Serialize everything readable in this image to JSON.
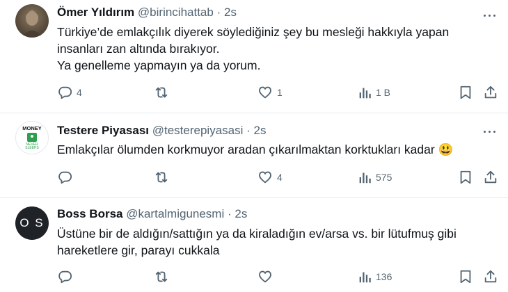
{
  "tweets": [
    {
      "name": "Ömer Yıldırım",
      "handle": "@birincihattab",
      "separator": "·",
      "time": "2s",
      "lines": [
        "Türkiye’de emlakçılık diyerek söylediğiniz şey bu mesleği hakkıyla yapan",
        "insanları zan altında bırakıyor.",
        "Ya genelleme yapmayın ya da yorum."
      ],
      "replies": "4",
      "retweets": "",
      "likes": "1",
      "views": "1 B",
      "avatar_icon": "profile-photo"
    },
    {
      "name": "Testere Piyasası",
      "handle": "@testerepiyasasi",
      "separator": "·",
      "time": "2s",
      "lines": [
        "Emlakçılar ölumden korkmuyor aradan çıkarılmaktan korktukları kadar"
      ],
      "emoji": "😃",
      "replies": "",
      "retweets": "",
      "likes": "4",
      "views": "575",
      "avatar_top": "MONEY",
      "avatar_bottom": "NEVER SLEEPS"
    },
    {
      "name": "Boss Borsa",
      "handle": "@kartalmigunesmi",
      "separator": "·",
      "time": "2s",
      "lines": [
        "Üstüne bir de aldığın/sattığın ya da kiraladığın ev/arsa vs. bir lütufmuş gibi",
        "hareketlere gir, parayı cukkala"
      ],
      "replies": "",
      "retweets": "",
      "likes": "",
      "views": "136",
      "avatar_letters": "O S"
    }
  ],
  "colors": {
    "text": "#0f1419",
    "secondary": "#536471",
    "divider": "#e6e9ec",
    "money_green": "#2e9e4f"
  }
}
